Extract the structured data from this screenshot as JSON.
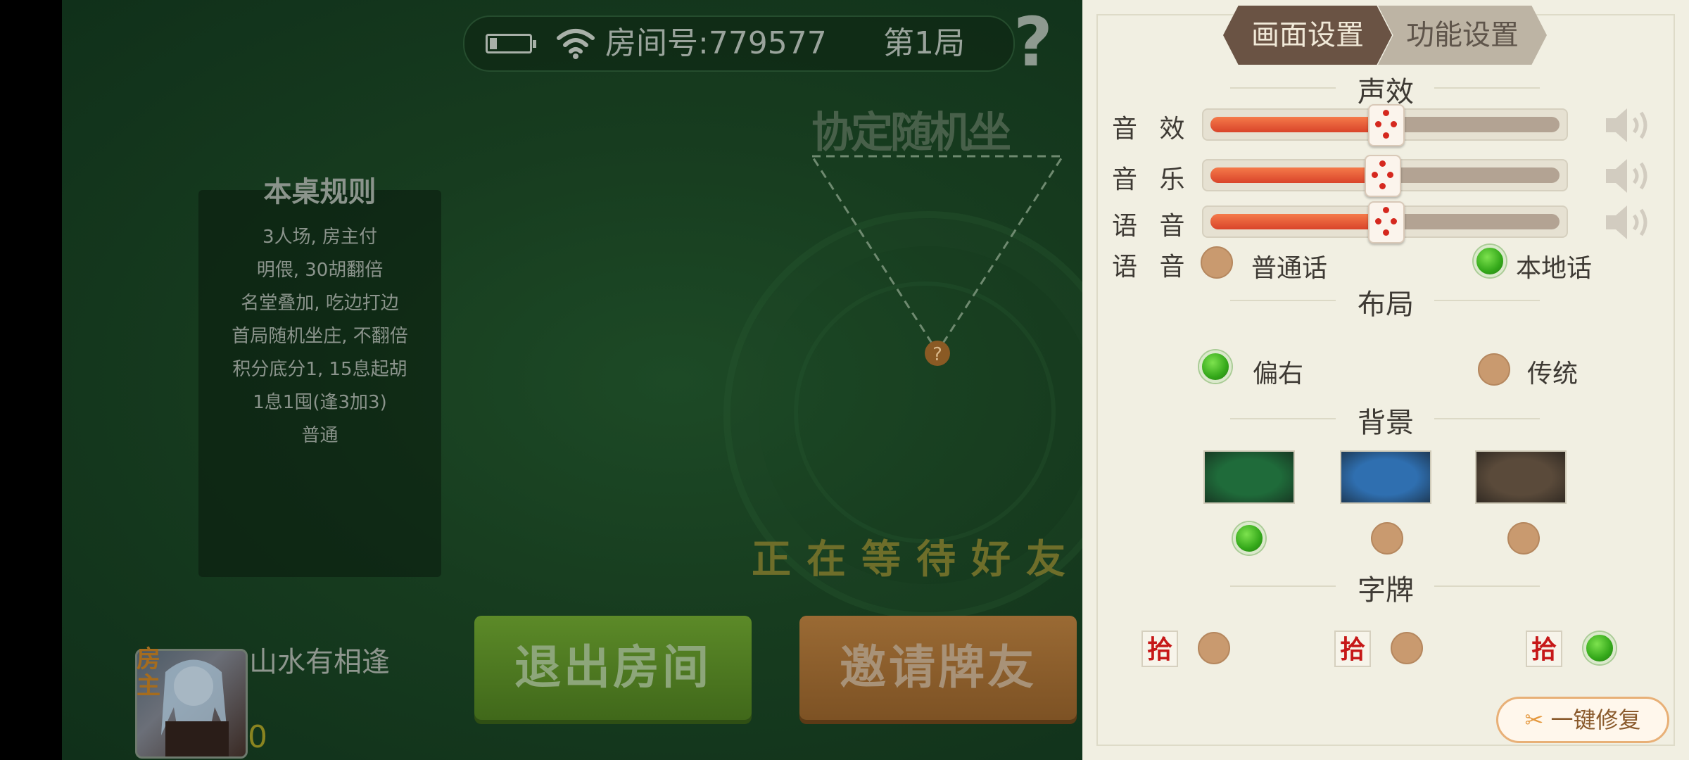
{
  "top_bar": {
    "room_label": "房间号:779577",
    "round_label": "第1局"
  },
  "help_icon": "question-mark",
  "seat_title": "协定随机坐",
  "rules": {
    "title": "本桌规则",
    "lines": [
      "3人场, 房主付",
      "明偎, 30胡翻倍",
      "名堂叠加, 吃边打边",
      "首局随机坐庄, 不翻倍",
      "积分底分1, 15息起胡",
      "1息1囤(逢3加3)",
      "普通"
    ]
  },
  "waiting_text": "正在等待好友...",
  "buttons": {
    "exit": "退出房间",
    "invite": "邀请牌友"
  },
  "player": {
    "host_tag": "房主",
    "name": "山水有相逢",
    "score": "0"
  },
  "settings": {
    "tabs": {
      "active": "画面设置",
      "inactive": "功能设置"
    },
    "sound": {
      "title": "声效",
      "sliders": [
        {
          "label": "音 效",
          "value": 50
        },
        {
          "label": "音 乐",
          "value": 49
        },
        {
          "label": "语 音",
          "value": 50
        }
      ],
      "voice": {
        "label": "语 音",
        "options": [
          {
            "label": "普通话",
            "selected": false
          },
          {
            "label": "本地话",
            "selected": true
          }
        ]
      }
    },
    "layout": {
      "title": "布局",
      "options": [
        {
          "label": "偏右",
          "selected": true
        },
        {
          "label": "传统",
          "selected": false
        }
      ]
    },
    "background": {
      "title": "背景",
      "selected_index": 0,
      "colors": [
        "#1f6b3a",
        "#2f6fb0",
        "#5a4a3a"
      ]
    },
    "tiles": {
      "title": "字牌",
      "glyph": "拾",
      "selected_index": 2
    },
    "repair_label": "一键修复"
  },
  "colors": {
    "accent_orange": "#e4552f",
    "selected_green": "#34a81a",
    "tab_active": "#6a5344"
  }
}
